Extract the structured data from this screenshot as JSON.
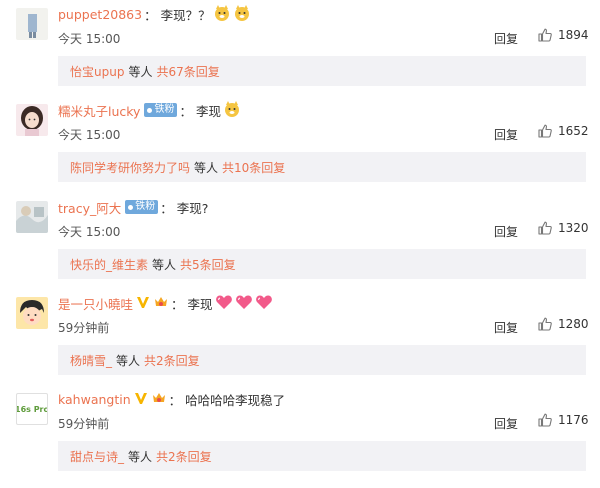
{
  "comments": [
    {
      "username": "puppet20863",
      "colon": "：",
      "text": "李现？？",
      "emojis": [
        "doge-emoji",
        "doge-emoji"
      ],
      "time": "今天 15:00",
      "reply_label": "回复",
      "likes": "1894",
      "sub": {
        "user": "怡宝upup",
        "mid": "等人",
        "total": "共67条回复"
      }
    },
    {
      "username": "糯米丸子lucky",
      "fan_badge": "铁粉",
      "colon": "：",
      "text": "李现",
      "emojis": [
        "doge-emoji"
      ],
      "time": "今天 15:00",
      "reply_label": "回复",
      "likes": "1652",
      "sub": {
        "user": "陈同学考研你努力了吗",
        "mid": "等人",
        "total": "共10条回复"
      }
    },
    {
      "username": "tracy_阿大",
      "fan_badge": "铁粉",
      "colon": "：",
      "text": "李现?",
      "time": "今天 15:00",
      "reply_label": "回复",
      "likes": "1320",
      "sub": {
        "user": "快乐的_维生素",
        "mid": "等人",
        "total": "共5条回复"
      }
    },
    {
      "username": "是一只小曉哇",
      "colon": "：",
      "text": "李现",
      "emojis": [
        "heart-emoji",
        "heart-emoji",
        "heart-emoji"
      ],
      "time": "59分钟前",
      "reply_label": "回复",
      "likes": "1280",
      "sub": {
        "user": "杨晴雪_",
        "mid": "等人",
        "total": "共2条回复"
      }
    },
    {
      "username": "kahwangtin",
      "colon": "：",
      "text": "哈哈哈哈李现稳了",
      "time": "59分钟前",
      "reply_label": "回复",
      "likes": "1176",
      "avatar_text": "16s Pro",
      "sub": {
        "user": "甜点与诗_",
        "mid": "等人",
        "total": "共2条回复"
      }
    }
  ],
  "colors": {
    "accent": "#eb7350",
    "subbox_bg": "#f2f2f5",
    "fan_badge": "#6fa8dc"
  }
}
